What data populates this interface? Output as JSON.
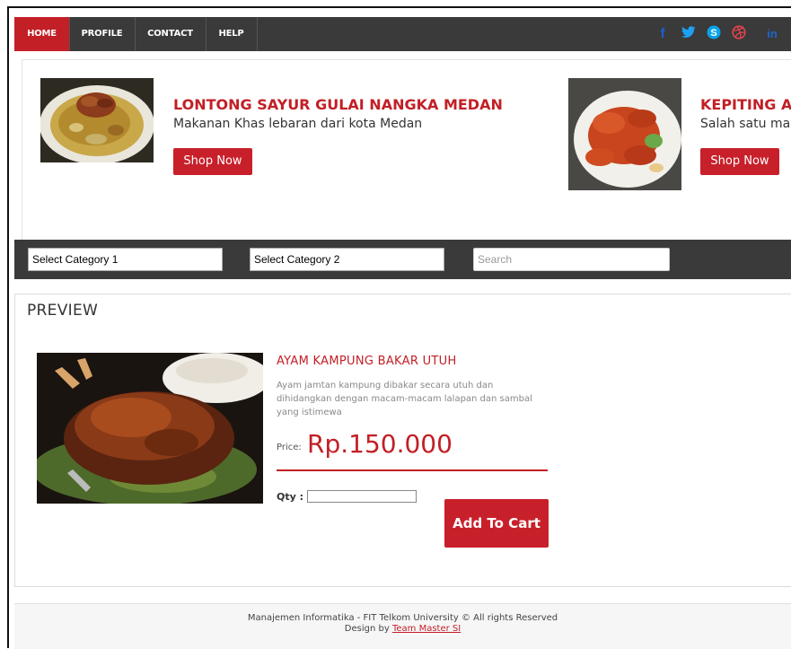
{
  "nav": {
    "items": [
      {
        "label": "HOME",
        "active": true
      },
      {
        "label": "PROFILE",
        "active": false
      },
      {
        "label": "CONTACT",
        "active": false
      },
      {
        "label": "HELP",
        "active": false
      }
    ],
    "social_icons": [
      {
        "name": "facebook-icon",
        "glyph": "f",
        "color": "#1a5fd6"
      },
      {
        "name": "twitter-icon",
        "glyph": "t",
        "color": "#1da1f2"
      },
      {
        "name": "skype-icon",
        "glyph": "S",
        "color": "#0aa2e8"
      },
      {
        "name": "dribbble-icon",
        "glyph": "⊛",
        "color": "#e7424e"
      },
      {
        "name": "linkedin-icon",
        "glyph": "in",
        "color": "#1e66c9"
      }
    ]
  },
  "banner": {
    "slides": [
      {
        "title": "LONTONG SAYUR GULAI NANGKA MEDAN",
        "subtitle": "Makanan Khas lebaran dari kota Medan",
        "button": "Shop Now"
      },
      {
        "title": "KEPITING AS",
        "subtitle": "Salah satu ma",
        "button": "Shop Now"
      }
    ]
  },
  "filter": {
    "category1": "Select Category 1",
    "category2": "Select Category 2",
    "search_placeholder": "Search"
  },
  "preview": {
    "heading": "PREVIEW",
    "product_name": "AYAM KAMPUNG BAKAR UTUH",
    "description": "Ayam jamtan kampung dibakar secara utuh dan dihidangkan dengan macam-macam lalapan dan sambal yang istimewa",
    "price_label": "Price:",
    "price": "Rp.150.000",
    "qty_label": "Qty :",
    "add_to_cart": "Add To Cart"
  },
  "footer": {
    "copyright": "Manajemen Informatika - FIT Telkom University © All rights Reserved",
    "design_by": "Design by",
    "team": "Team Master SI"
  },
  "colors": {
    "accent": "#c21f26",
    "dark_bar": "#3a3a3a"
  }
}
